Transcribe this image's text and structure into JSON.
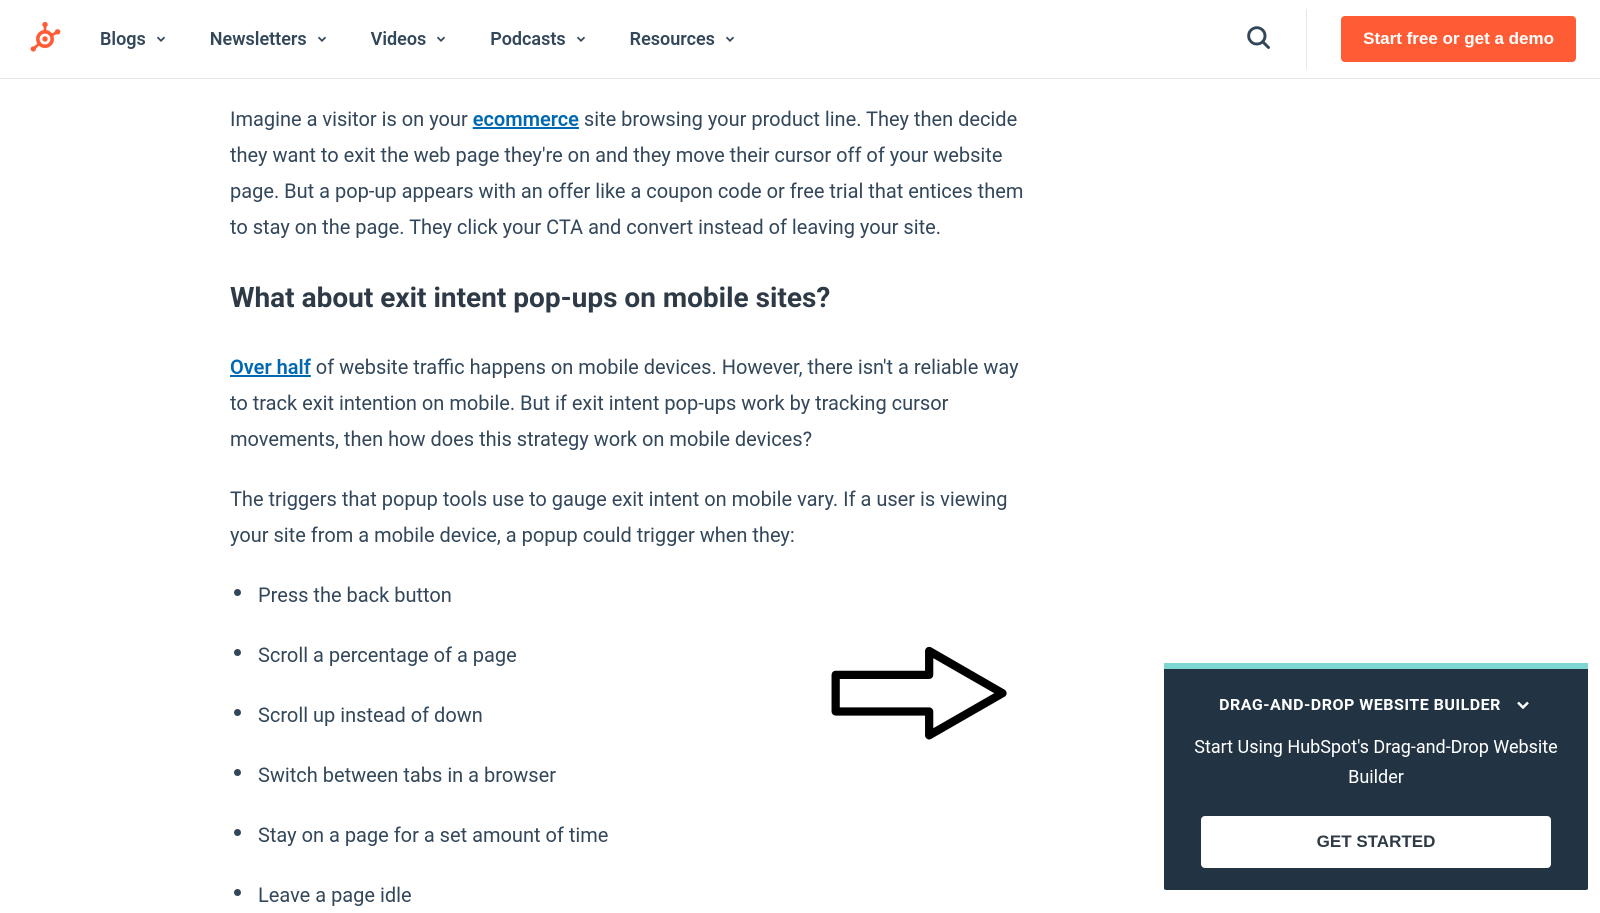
{
  "nav": {
    "items": [
      "Blogs",
      "Newsletters",
      "Videos",
      "Podcasts",
      "Resources"
    ],
    "cta": "Start free or get a demo"
  },
  "content": {
    "para1_pre": "Imagine a visitor is on your ",
    "para1_link": "ecommerce",
    "para1_post": " site browsing your product line. They then decide they want to exit the web page they're on and they move their cursor off of your website page. But a pop-up appears with an offer like a coupon code or free trial that entices them to stay on the page. They click your CTA and convert instead of leaving your site.",
    "heading": "What about exit intent pop-ups on mobile sites?",
    "para2_linktext": "Over half",
    "para2_post": " of website traffic happens on mobile devices. However, there isn't a reliable way to track exit intention on mobile. But if exit intent pop-ups work by tracking cursor movements, then how does this strategy work on mobile devices?",
    "para3": "The triggers that popup tools use to gauge exit intent on mobile vary. If a user is viewing your site from a mobile device, a popup could trigger when they:",
    "bullets": [
      "Press the back button",
      "Scroll a percentage of a page",
      "Scroll up instead of down",
      "Switch between tabs in a browser",
      "Stay on a page for a set amount of time",
      "Leave a page idle"
    ]
  },
  "sticky": {
    "title": "DRAG-AND-DROP WEBSITE BUILDER",
    "subtitle": "Start Using HubSpot's Drag-and-Drop Website Builder",
    "button": "GET STARTED"
  }
}
